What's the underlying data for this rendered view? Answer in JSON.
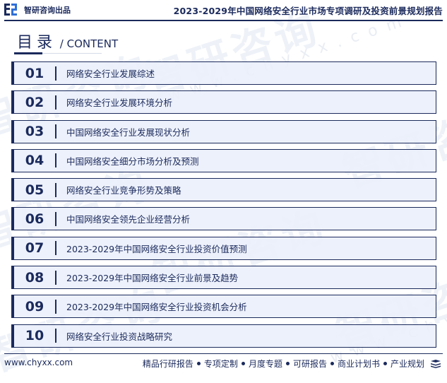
{
  "header": {
    "brand": "智研咨询出品",
    "report_title": "2023-2029年中国网络安全行业市场专项调研及投资前景规划报告",
    "logo_icon": "chyxx-logo-icon"
  },
  "toc": {
    "title_cn": "目录",
    "title_separator": " / ",
    "title_en": "CONTENT",
    "items": [
      {
        "num": "01",
        "label": "网络安全行业发展综述"
      },
      {
        "num": "02",
        "label": "网络安全行业发展环境分析"
      },
      {
        "num": "03",
        "label": "中国网络安全行业发展现状分析"
      },
      {
        "num": "04",
        "label": "中国网络安全细分市场分析及预测"
      },
      {
        "num": "05",
        "label": "网络安全行业竞争形势及策略"
      },
      {
        "num": "06",
        "label": "中国网络安全领先企业经营分析"
      },
      {
        "num": "07",
        "label": "2023-2029年中国网络安全行业投资价值预测"
      },
      {
        "num": "08",
        "label": "2023-2029年中国网络安全行业前景及趋势"
      },
      {
        "num": "09",
        "label": "2023-2029年中国网络安全行业投资机会分析"
      },
      {
        "num": "10",
        "label": "网络安全行业投资战略研究"
      }
    ]
  },
  "footer": {
    "website": "www.chyxx.com",
    "services": [
      "精品行研报告",
      "专项定制",
      "月度专题",
      "可研报告",
      "商业计划书",
      "产业规划"
    ],
    "end_icon": "stack-icon"
  },
  "watermark": {
    "text": "智研咨询",
    "url": "www.chyxx.com"
  },
  "colors": {
    "primary": "#1b2a5c",
    "row_background": "#eaeffa",
    "logo_accent": "#2f6fd6"
  }
}
